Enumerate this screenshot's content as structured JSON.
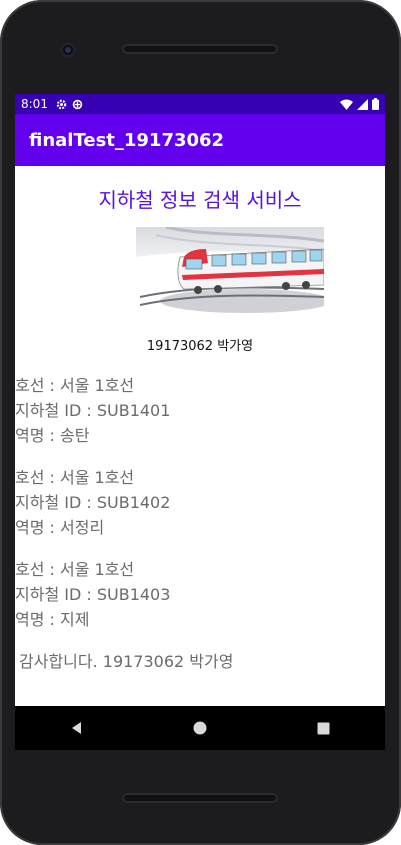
{
  "status": {
    "time": "8:01",
    "left_icons": [
      "gear-icon",
      "data-saver-icon"
    ],
    "right_icons": [
      "wifi-icon",
      "signal-icon",
      "battery-icon"
    ]
  },
  "app": {
    "title": "finalTest_19173062",
    "accent": "#6200ee",
    "status_color": "#3700b3"
  },
  "main": {
    "heading": "지하철 정보 검색 서비스",
    "heading_color": "#5a12e0",
    "caption": "19173062 박가영",
    "stations": [
      {
        "line": "호선 : 서울 1호선",
        "id": "지하철 ID : SUB1401",
        "name": "역명 : 송탄"
      },
      {
        "line": "호선 : 서울 1호선",
        "id": "지하철 ID : SUB1402",
        "name": "역명 : 서정리"
      },
      {
        "line": "호선 : 서울 1호선",
        "id": "지하철 ID : SUB1403",
        "name": "역명 : 지제"
      }
    ],
    "thanks": "감사합니다. 19173062 박가영"
  },
  "navbar": {
    "icons": [
      "back-icon",
      "home-icon",
      "recents-icon"
    ]
  }
}
